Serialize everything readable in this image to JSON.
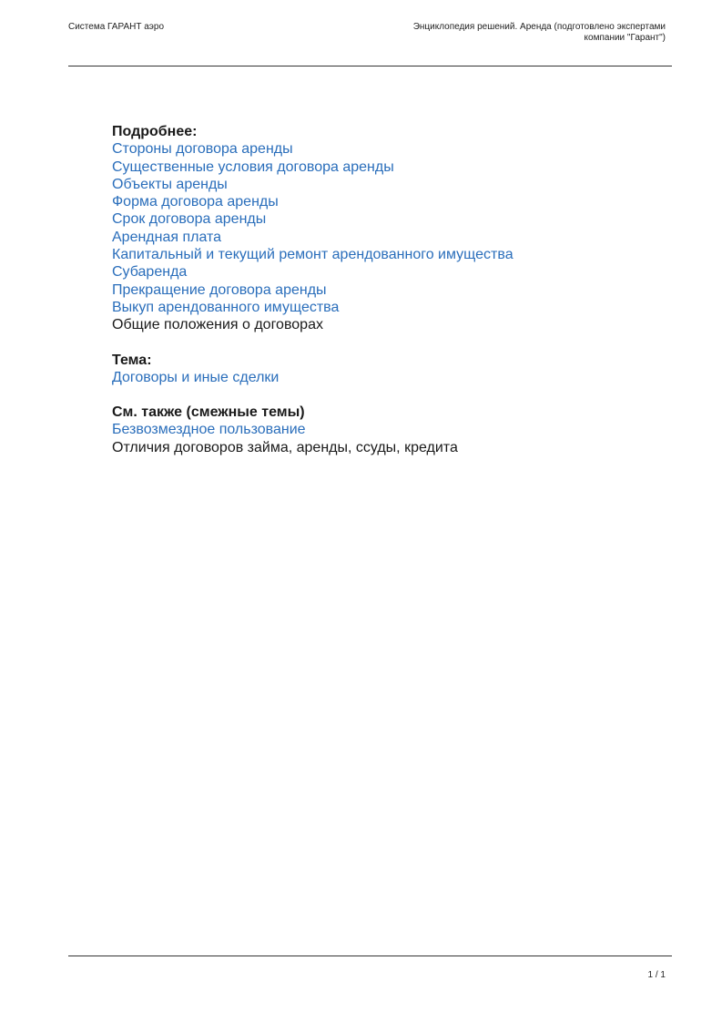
{
  "header": {
    "left": "Система ГАРАНТ аэро",
    "right_line1": "Энциклопедия решений. Аренда (подготовлено экспертами",
    "right_line2": "компании \"Гарант\")"
  },
  "sections": {
    "more": {
      "heading": "Подробнее:",
      "items": [
        "Стороны договора аренды",
        "Существенные условия договора аренды",
        "Объекты аренды",
        "Форма договора аренды",
        "Срок договора аренды",
        "Арендная плата",
        "Капитальный и текущий ремонт арендованного имущества",
        "Субаренда",
        "Прекращение договора аренды",
        "Выкуп арендованного имущества",
        "Общие положения о договорах"
      ]
    },
    "topic": {
      "heading": "Тема:",
      "items": [
        "Договоры и иные сделки"
      ]
    },
    "see_also": {
      "heading": "См. также (смежные темы)",
      "items": [
        "Безвозмездное пользование",
        "Отличия договоров займа, аренды, ссуды, кредита"
      ]
    }
  },
  "footer": {
    "page_number": "1 / 1"
  },
  "colors": {
    "link": "#2a6ebb",
    "text": "#1a1a1a"
  }
}
